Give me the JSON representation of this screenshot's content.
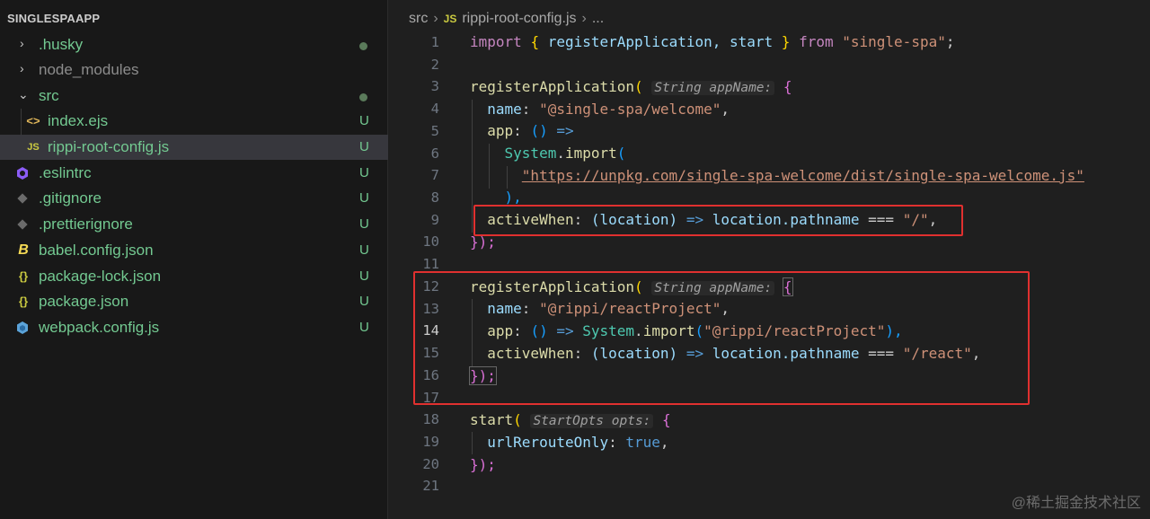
{
  "explorer": {
    "root": "SINGLESPAAPP",
    "items": [
      {
        "name": ".husky",
        "status": "dot",
        "color": "#73c991"
      },
      {
        "name": "node_modules",
        "status": "",
        "color": "#8c8c8c"
      },
      {
        "name": "src",
        "status": "dot",
        "color": "#73c991"
      },
      {
        "name": "index.ejs",
        "status": "U",
        "color": "#73c991",
        "icon": "<>"
      },
      {
        "name": "rippi-root-config.js",
        "status": "U",
        "color": "#73c991",
        "icon": "JS"
      },
      {
        "name": ".eslintrc",
        "status": "U",
        "color": "#73c991"
      },
      {
        "name": ".gitignore",
        "status": "U",
        "color": "#73c991"
      },
      {
        "name": ".prettierignore",
        "status": "U",
        "color": "#73c991"
      },
      {
        "name": "babel.config.json",
        "status": "U",
        "color": "#73c991",
        "icon": "B"
      },
      {
        "name": "package-lock.json",
        "status": "U",
        "color": "#73c991",
        "icon": "{}"
      },
      {
        "name": "package.json",
        "status": "U",
        "color": "#73c991",
        "icon": "{}"
      },
      {
        "name": "webpack.config.js",
        "status": "U",
        "color": "#73c991"
      }
    ]
  },
  "breadcrumb": {
    "folder": "src",
    "file_icon": "JS",
    "file": "rippi-root-config.js",
    "more": "..."
  },
  "code": {
    "active_line": 14,
    "line_numbers": [
      "1",
      "2",
      "3",
      "4",
      "5",
      "6",
      "7",
      "8",
      "9",
      "10",
      "11",
      "12",
      "13",
      "14",
      "15",
      "16",
      "17",
      "18",
      "19",
      "20",
      "21"
    ],
    "l1": {
      "import": "import",
      "ob": "{",
      "names": " registerApplication, start ",
      "cb": "}",
      "from": "from",
      "src": "\"single-spa\"",
      "semi": ";"
    },
    "l3": {
      "fn": "registerApplication",
      "paren": "(",
      "hint": "String appName:",
      "brace": "{"
    },
    "l4": {
      "key": "name",
      "colon": ": ",
      "val": "\"@single-spa/welcome\"",
      "comma": ","
    },
    "l5": {
      "key": "app",
      "colon": ": ",
      "parens": "()",
      "arrow": "=>"
    },
    "l6": {
      "obj": "System",
      "dot": ".",
      "fn": "import",
      "paren": "("
    },
    "l7": {
      "url": "\"https://unpkg.com/single-spa-welcome/dist/single-spa-welcome.js\""
    },
    "l8": {
      "close": "),"
    },
    "l9": {
      "key": "activeWhen",
      "colon": ": ",
      "param": "(location)",
      "arrow": "=>",
      "expr": "location.pathname",
      "op": "===",
      "val": "\"/\"",
      "comma": ","
    },
    "l10": {
      "close": "});"
    },
    "l12": {
      "fn": "registerApplication",
      "paren": "(",
      "hint": "String appName:",
      "brace": "{"
    },
    "l13": {
      "key": "name",
      "colon": ": ",
      "val": "\"@rippi/reactProject\"",
      "comma": ","
    },
    "l14": {
      "key": "app",
      "colon": ": ",
      "parens": "()",
      "arrow": "=>",
      "obj": "System",
      "dot": ".",
      "fn": "import",
      "paren": "(",
      "val": "\"@rippi/reactProject\"",
      "close": "),"
    },
    "l15": {
      "key": "activeWhen",
      "colon": ": ",
      "param": "(location)",
      "arrow": "=>",
      "expr": "location.pathname",
      "op": "===",
      "val": "\"/react\"",
      "comma": ","
    },
    "l16": {
      "close": "});"
    },
    "l18": {
      "fn": "start",
      "paren": "(",
      "hint": "StartOpts opts:",
      "brace": "{"
    },
    "l19": {
      "key": "urlRerouteOnly",
      "colon": ": ",
      "val": "true",
      "comma": ","
    },
    "l20": {
      "close": "});"
    }
  },
  "colors": {
    "highlight_box": "#e0302f",
    "untracked": "#73c991"
  },
  "watermark": "@稀土掘金技术社区"
}
